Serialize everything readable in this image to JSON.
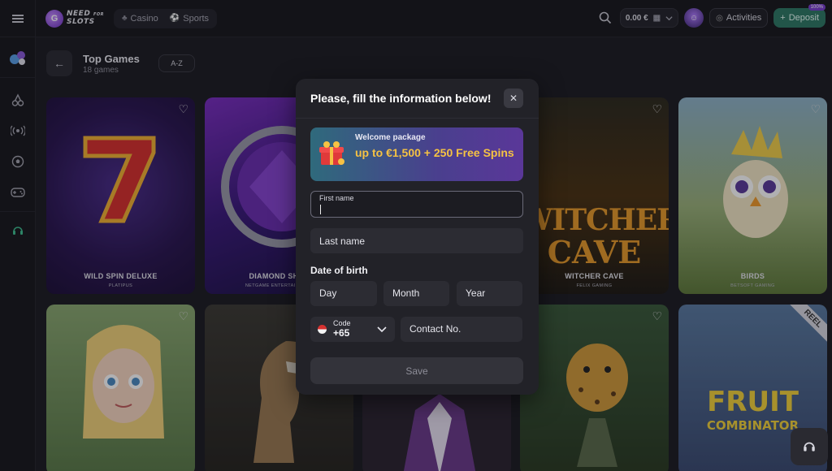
{
  "header": {
    "logo_text_line1": "NEED",
    "logo_text_line2": "SLOTS",
    "logo_text_small": "FOR",
    "nav": [
      {
        "label": "Casino",
        "icon": "cherries-icon"
      },
      {
        "label": "Sports",
        "icon": "soccer-ball-icon"
      }
    ],
    "balance": "0.00 €",
    "activities_label": "Activities",
    "deposit_label": "Deposit",
    "deposit_badge": "100%"
  },
  "sidebar": {
    "items": [
      {
        "icon": "casino-games-icon"
      },
      {
        "icon": "cherries-icon"
      },
      {
        "icon": "live-broadcast-icon"
      },
      {
        "icon": "soccer-ball-icon"
      },
      {
        "icon": "gamepad-icon"
      },
      {
        "icon": "support-headset-icon"
      }
    ]
  },
  "section": {
    "title": "Top Games",
    "subtitle": "18 games",
    "sort_label": "A-Z"
  },
  "games": [
    {
      "name": "WILD SPIN DELUXE",
      "provider": "PLATIPUS"
    },
    {
      "name": "DIAMOND SHOT",
      "provider": "NETGAME ENTERTAINMENT"
    },
    {
      "name": "",
      "provider": ""
    },
    {
      "name": "WITCHER CAVE",
      "provider": "FELIX GAMING"
    },
    {
      "name": "BIRDS",
      "provider": "BETSOFT GAMING"
    },
    {
      "name": "",
      "provider": ""
    },
    {
      "name": "",
      "provider": ""
    },
    {
      "name": "",
      "provider": ""
    },
    {
      "name": "",
      "provider": ""
    },
    {
      "name": "",
      "provider": ""
    }
  ],
  "card_art_text": {
    "witcher": "WITCHER",
    "cave": "CAVE",
    "fruit": "FRUIT",
    "combinator": "COMBINATOR",
    "reel": "REEL"
  },
  "modal": {
    "title": "Please, fill the information below!",
    "promo_pre": "Welcome package",
    "promo_main": "up to €1,500 + 250 Free Spins",
    "first_name_label": "First name",
    "last_name_placeholder": "Last name",
    "dob_label": "Date of birth",
    "day_placeholder": "Day",
    "month_placeholder": "Month",
    "year_placeholder": "Year",
    "code_label": "Code",
    "code_value": "+65",
    "contact_placeholder": "Contact No.",
    "save_label": "Save"
  },
  "colors": {
    "background": "#1c1c22",
    "modal": "#222228",
    "deposit": "#2f7a65",
    "promo_accent": "#f5c243"
  }
}
